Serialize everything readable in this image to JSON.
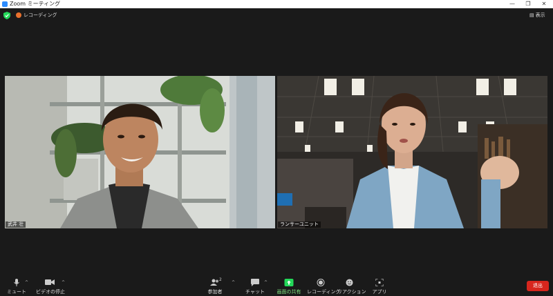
{
  "window": {
    "title": "Zoom ミーティング",
    "minimize_glyph": "—",
    "maximize_glyph": "❐",
    "close_glyph": "✕"
  },
  "status": {
    "recording_label": "レコーディング",
    "view_label": "表示",
    "recording_color": "#e8712d",
    "shield_color": "#23d959"
  },
  "participants": [
    {
      "name": "武井 壮"
    },
    {
      "name": "ランサーユニット"
    }
  ],
  "toolbar": {
    "mute_label": "ミュート",
    "video_label": "ビデオの停止",
    "participants_label": "参加者",
    "participants_count": "2",
    "chat_label": "チャット",
    "share_label": "画面の共有",
    "record_label": "レコーディング",
    "reaction_label": "リアクション",
    "apps_label": "アプリ",
    "end_label": "退出",
    "share_color": "#23d959",
    "end_color": "#d7261d"
  }
}
